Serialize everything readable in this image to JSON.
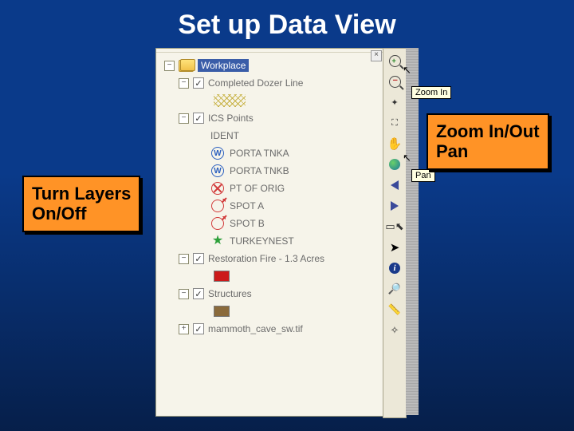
{
  "title": "Set up Data View",
  "callouts": {
    "zoom_pan": "Zoom In/Out",
    "zoom_pan_line2": "Pan",
    "layers": "Turn Layers",
    "layers_line2": "On/Off"
  },
  "tooltips": {
    "zoom_in": "Zoom In",
    "pan": "Pan"
  },
  "toc": {
    "root": "Workplace",
    "layer_dozer": "Completed Dozer Line",
    "layer_ics": "ICS Points",
    "ics_field": "IDENT",
    "points": {
      "tnka": "PORTA TNKA",
      "tnkb": "PORTA TNKB",
      "orig": "PT OF ORIG",
      "spota": "SPOT A",
      "spotb": "SPOT B",
      "turkey": "TURKEYNEST"
    },
    "layer_fire": "Restoration Fire - 1.3 Acres",
    "layer_struct": "Structures",
    "layer_raster": "mammoth_cave_sw.tif"
  },
  "toolbar_icons": [
    "zoom-in",
    "zoom-out",
    "fixed-zoom-in",
    "fixed-zoom-out",
    "pan",
    "full-extent",
    "back",
    "forward",
    "select-features",
    "select-elements",
    "identify",
    "find",
    "measure",
    "go-to-xy"
  ]
}
